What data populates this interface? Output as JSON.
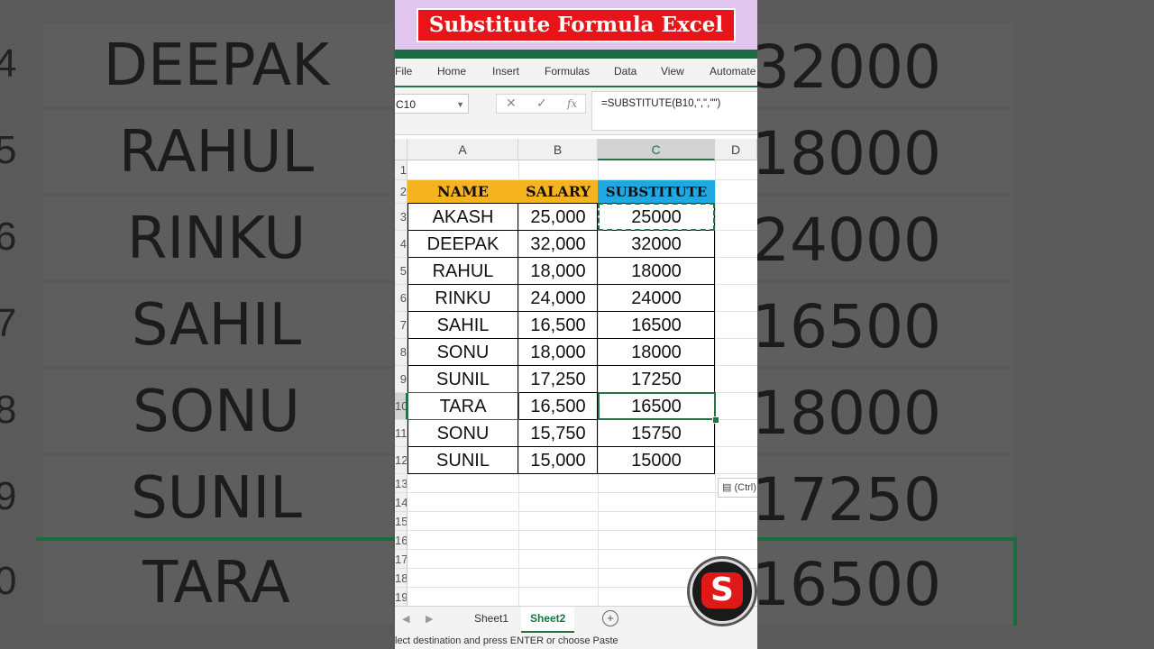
{
  "banner": {
    "title": "Substitute Formula Excel"
  },
  "menu": [
    "File",
    "Home",
    "Insert",
    "Formulas",
    "Data",
    "View",
    "Automate"
  ],
  "formula_bar": {
    "name_box": "C10",
    "formula": "=SUBSTITUTE(B10,\",\",\"\")",
    "cancel_glyph": "✕",
    "enter_glyph": "✓",
    "fx_glyph": "fx"
  },
  "columns": [
    "A",
    "B",
    "C",
    "D"
  ],
  "row_numbers": [
    "1",
    "2",
    "3",
    "4",
    "5",
    "6",
    "7",
    "8",
    "9",
    "10",
    "11",
    "12",
    "13",
    "14",
    "15",
    "16",
    "17",
    "18",
    "19"
  ],
  "table": {
    "headers": [
      "NAME",
      "SALARY",
      "SUBSTITUTE"
    ],
    "header_colors": [
      "#f5b41f",
      "#f5b41f",
      "#20a9e1"
    ],
    "rows": [
      [
        "AKASH",
        "25,000",
        "25000"
      ],
      [
        "DEEPAK",
        "32,000",
        "32000"
      ],
      [
        "RAHUL",
        "18,000",
        "18000"
      ],
      [
        "RINKU",
        "24,000",
        "24000"
      ],
      [
        "SAHIL",
        "16,500",
        "16500"
      ],
      [
        "SONU",
        "18,000",
        "18000"
      ],
      [
        "SUNIL",
        "17,250",
        "17250"
      ],
      [
        "TARA",
        "16,500",
        "16500"
      ],
      [
        "SONU",
        "15,750",
        "15750"
      ],
      [
        "SUNIL",
        "15,000",
        "15000"
      ]
    ]
  },
  "paste_options": "(Ctrl)",
  "sheets": [
    "Sheet1",
    "Sheet2"
  ],
  "active_sheet": "Sheet2",
  "status_text": "lect destination and press ENTER or choose Paste",
  "background_left": {
    "row_numbers": [
      "4",
      "5",
      "6",
      "7",
      "8",
      "9",
      "0"
    ],
    "names": [
      "DEEPAK",
      "RAHUL",
      "RINKU",
      "SAHIL",
      "SONU",
      "SUNIL",
      "TARA"
    ]
  },
  "background_right": {
    "values": [
      "32000",
      "18000",
      "24000",
      "16500",
      "18000",
      "17250",
      "16500"
    ]
  },
  "logo": {
    "letter": "S"
  },
  "accent_color": "#217346"
}
